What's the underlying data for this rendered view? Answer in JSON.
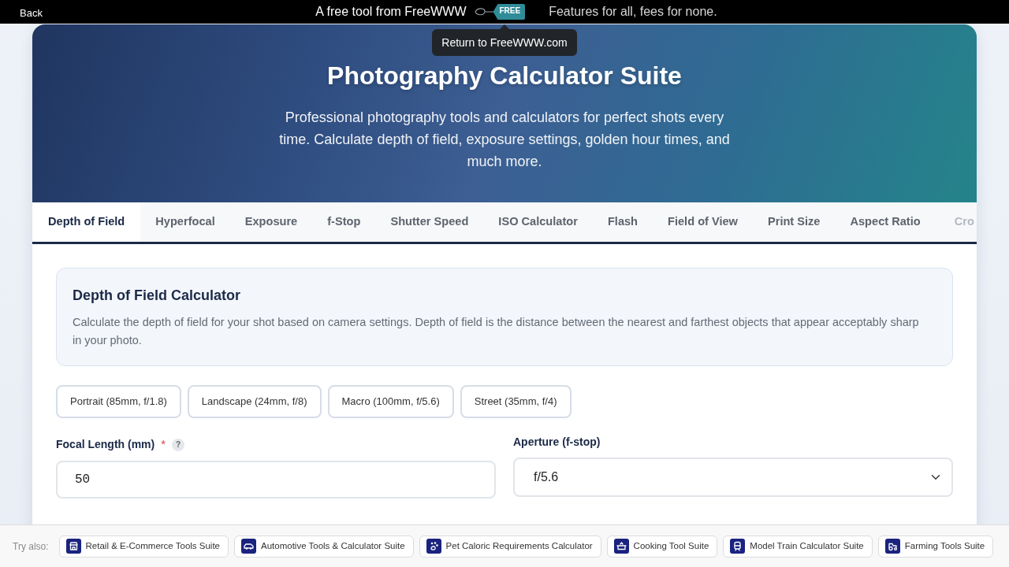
{
  "top_bar": {
    "back": "Back",
    "tagline_left": "A free tool from FreeWWW",
    "badge": "FREE",
    "tagline_right": "Features for all, fees for none.",
    "tooltip": "Return to FreeWWW.com"
  },
  "hero": {
    "title": "Photography Calculator Suite",
    "subtitle": "Professional photography tools and calculators for perfect shots every time. Calculate depth of field, exposure settings, golden hour times, and much more."
  },
  "tabs": [
    {
      "label": "Depth of Field",
      "selected": true
    },
    {
      "label": "Hyperfocal",
      "selected": false
    },
    {
      "label": "Exposure",
      "selected": false
    },
    {
      "label": "f-Stop",
      "selected": false
    },
    {
      "label": "Shutter Speed",
      "selected": false
    },
    {
      "label": "ISO Calculator",
      "selected": false
    },
    {
      "label": "Flash",
      "selected": false
    },
    {
      "label": "Field of View",
      "selected": false
    },
    {
      "label": "Print Size",
      "selected": false
    },
    {
      "label": "Aspect Ratio",
      "selected": false
    },
    {
      "label": "Cro",
      "selected": false
    }
  ],
  "calculator": {
    "title": "Depth of Field Calculator",
    "description": "Calculate the depth of field for your shot based on camera settings. Depth of field is the distance between the nearest and farthest objects that appear acceptably sharp in your photo.",
    "presets": [
      "Portrait (85mm, f/1.8)",
      "Landscape (24mm, f/8)",
      "Macro (100mm, f/5.6)",
      "Street (35mm, f/4)"
    ],
    "fields": [
      {
        "kind": "input",
        "label": "Focal Length (mm)",
        "required_mark": "*",
        "help": "?",
        "value": "50"
      },
      {
        "kind": "select",
        "label": "Aperture (f-stop)",
        "value": "f/5.6"
      }
    ]
  },
  "footer": {
    "label": "Try also:",
    "links": [
      "Retail & E-Commerce Tools Suite",
      "Automotive Tools & Calculator Suite",
      "Pet Caloric Requirements Calculator",
      "Cooking Tool Suite",
      "Model Train Calculator Suite",
      "Farming Tools Suite"
    ]
  }
}
